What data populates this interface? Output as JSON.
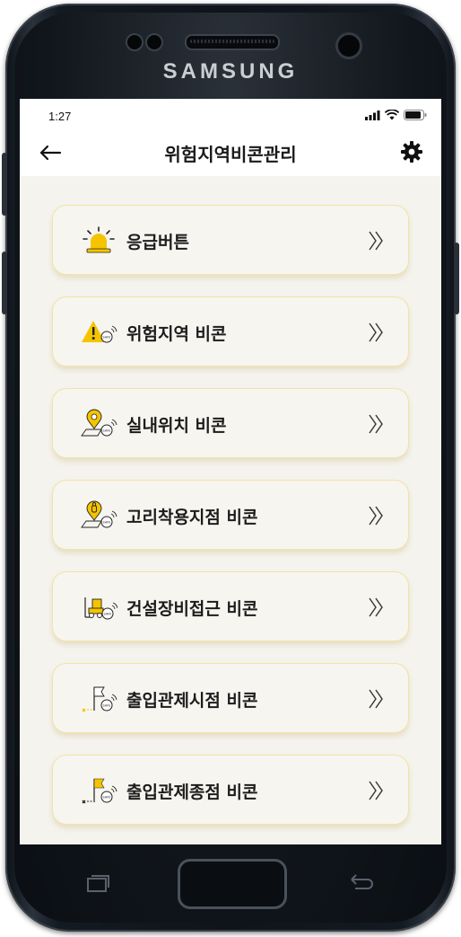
{
  "device": {
    "brand": "SAMSUNG"
  },
  "status_bar": {
    "time": "1:27"
  },
  "app_bar": {
    "title": "위험지역비콘관리"
  },
  "menu": {
    "items": [
      {
        "label": "응급버튼",
        "icon": "siren-icon"
      },
      {
        "label": "위험지역 비콘",
        "icon": "warning-beacon-icon"
      },
      {
        "label": "실내위치 비콘",
        "icon": "location-beacon-icon"
      },
      {
        "label": "고리착용지점 비콘",
        "icon": "harness-beacon-icon"
      },
      {
        "label": "건설장비접근 비콘",
        "icon": "equipment-beacon-icon"
      },
      {
        "label": "출입관제시점 비콘",
        "icon": "start-flag-beacon-icon"
      },
      {
        "label": "출입관제종점 비콘",
        "icon": "end-flag-beacon-icon"
      }
    ]
  },
  "colors": {
    "accent": "#f5c400",
    "card_border": "#f2e3a6",
    "background": "#f5f3ee"
  }
}
